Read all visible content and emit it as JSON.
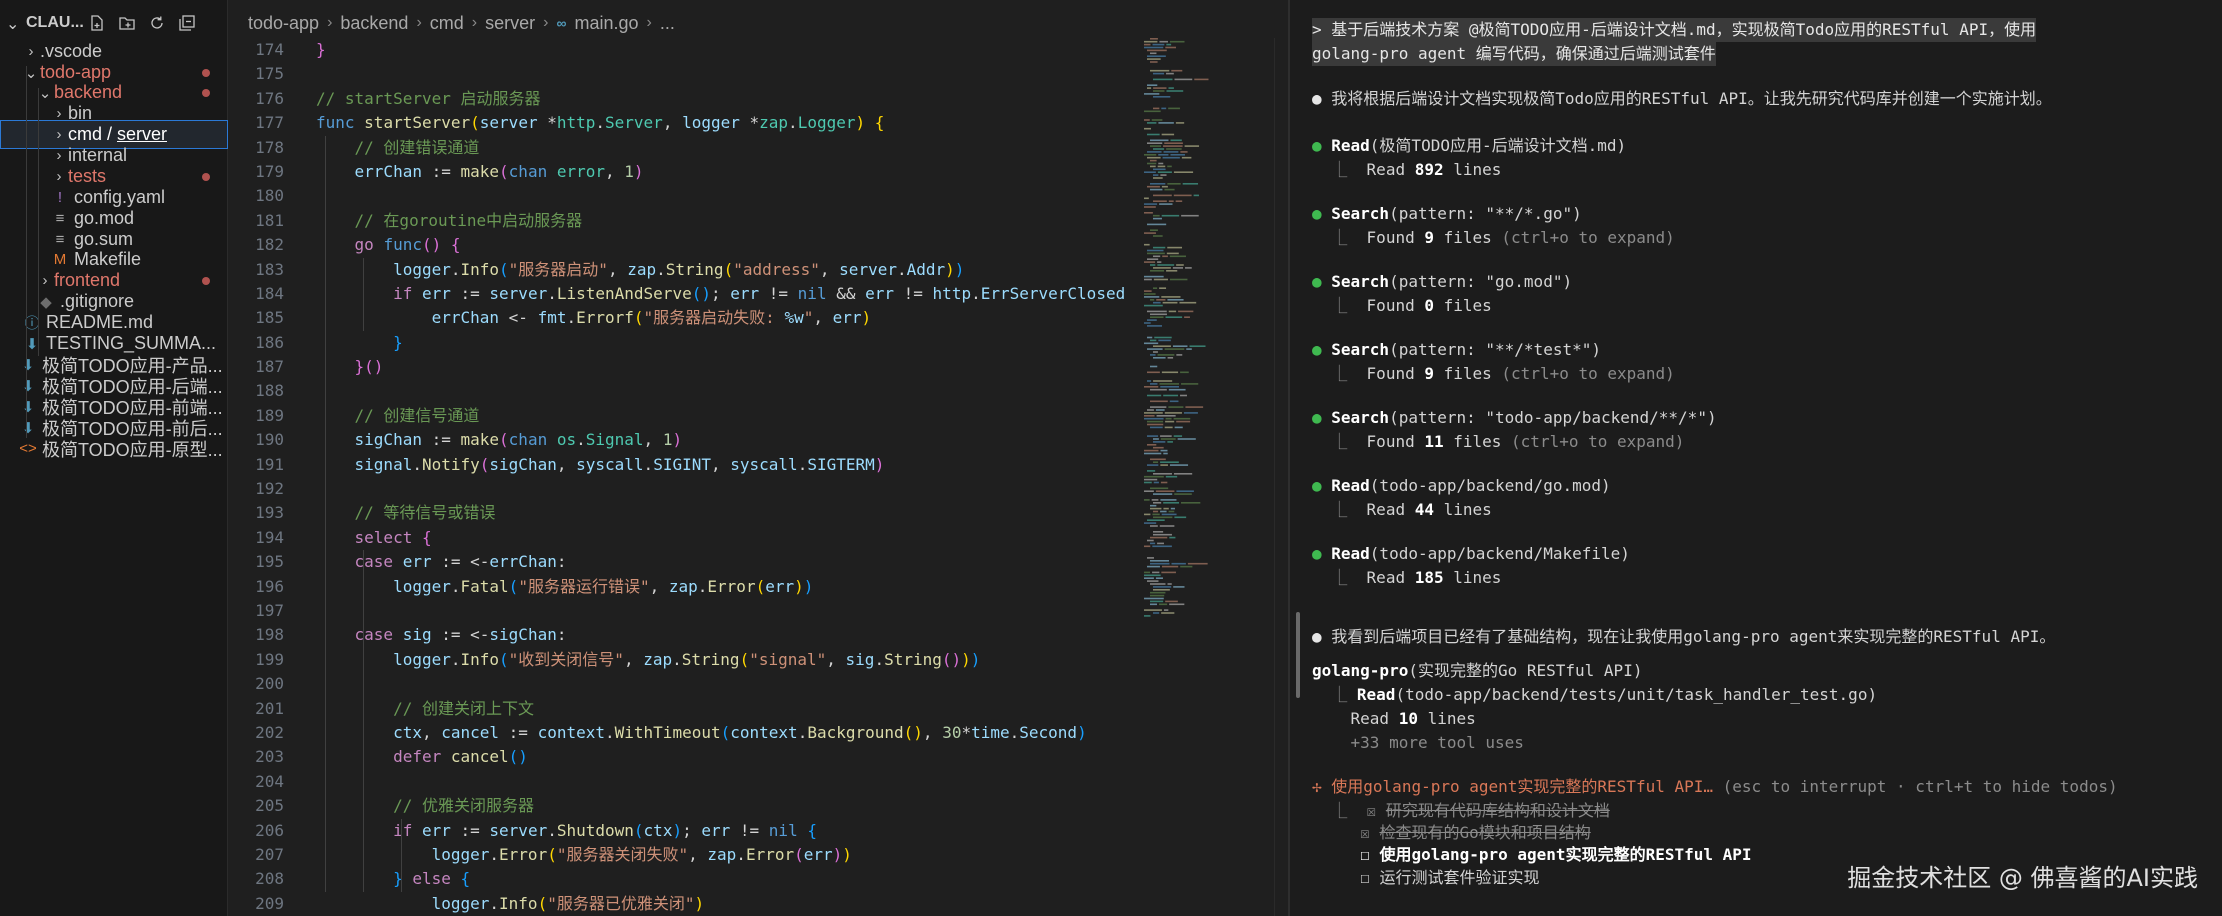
{
  "explorer": {
    "title": "CLAU...",
    "tree": [
      {
        "label": "→"
      },
      {
        "label": ".vscode",
        "indent": 1,
        "twisty": "›",
        "icon": "",
        "color": "#cccccc"
      },
      {
        "label": "todo-app",
        "indent": 1,
        "twisty": "⌄",
        "icon": "",
        "color": "#e0776b",
        "dot": true
      },
      {
        "label": "backend",
        "indent": 2,
        "twisty": "⌄",
        "icon": "",
        "color": "#e0776b",
        "dot": true
      },
      {
        "label": "bin",
        "indent": 3,
        "twisty": "›",
        "icon": "",
        "color": "#cccccc"
      },
      {
        "label": "cmd / server",
        "indent": 3,
        "twisty": "›",
        "icon": "",
        "color": "#ffffff",
        "selected": true
      },
      {
        "label": "internal",
        "indent": 3,
        "twisty": "›",
        "icon": "",
        "color": "#cccccc"
      },
      {
        "label": "tests",
        "indent": 3,
        "twisty": "›",
        "icon": "",
        "color": "#e0776b",
        "dot": true
      },
      {
        "label": "config.yaml",
        "indent": 3,
        "twisty": "",
        "icon": "!",
        "iconColor": "#a074c4",
        "color": "#cccccc"
      },
      {
        "label": "go.mod",
        "indent": 3,
        "twisty": "",
        "icon": "≡",
        "iconColor": "#aaaaaa",
        "color": "#cccccc"
      },
      {
        "label": "go.sum",
        "indent": 3,
        "twisty": "",
        "icon": "≡",
        "iconColor": "#aaaaaa",
        "color": "#cccccc"
      },
      {
        "label": "Makefile",
        "indent": 3,
        "twisty": "",
        "icon": "M",
        "iconColor": "#e37933",
        "color": "#cccccc"
      },
      {
        "label": "frontend",
        "indent": 2,
        "twisty": "›",
        "icon": "",
        "color": "#e0776b",
        "dot": true
      },
      {
        "label": ".gitignore",
        "indent": 2,
        "twisty": "",
        "icon": "◆",
        "iconColor": "#6d6d6d",
        "color": "#cccccc"
      },
      {
        "label": "README.md",
        "indent": 1,
        "twisty": "",
        "icon": "ⓘ",
        "iconColor": "#519aba",
        "color": "#cccccc"
      },
      {
        "label": "TESTING_SUMMA...",
        "indent": 1,
        "twisty": "",
        "icon": "⬇",
        "iconColor": "#519aba",
        "color": "#cccccc"
      },
      {
        "label": "极简TODO应用-产品...",
        "indent": 0,
        "twisty": "",
        "icon": "⬇",
        "iconColor": "#519aba",
        "color": "#cccccc"
      },
      {
        "label": "极简TODO应用-后端...",
        "indent": 0,
        "twisty": "",
        "icon": "⬇",
        "iconColor": "#519aba",
        "color": "#cccccc"
      },
      {
        "label": "极简TODO应用-前端...",
        "indent": 0,
        "twisty": "",
        "icon": "⬇",
        "iconColor": "#519aba",
        "color": "#cccccc"
      },
      {
        "label": "极简TODO应用-前后...",
        "indent": 0,
        "twisty": "",
        "icon": "⬇",
        "iconColor": "#519aba",
        "color": "#cccccc"
      },
      {
        "label": "极简TODO应用-原型...",
        "indent": 0,
        "twisty": "",
        "icon": "<>",
        "iconColor": "#e37933",
        "color": "#cccccc"
      }
    ]
  },
  "breadcrumbs": [
    "todo-app",
    "backend",
    "cmd",
    "server",
    "main.go",
    "..."
  ],
  "editor": {
    "lines": [
      {
        "n": "174",
        "html": "<span class='br2'>}</span>"
      },
      {
        "n": "175",
        "html": ""
      },
      {
        "n": "176",
        "html": "<span class='cm'>// startServer 启动服务器</span>"
      },
      {
        "n": "177",
        "html": "<span class='kw'>func</span> <span class='fn'>startServer</span><span class='br1'>(</span><span class='vr'>server</span> *<span class='ty'>http</span>.<span class='ty'>Server</span>, <span class='vr'>logger</span> *<span class='ty'>zap</span>.<span class='ty'>Logger</span><span class='br1'>)</span> <span class='br1'>{</span>"
      },
      {
        "n": "178",
        "html": "    <span class='cm'>// 创建错误通道</span>"
      },
      {
        "n": "179",
        "html": "    <span class='vr'>errChan</span> := <span class='fn'>make</span><span class='br2'>(</span><span class='kw'>chan</span> <span class='ty'>error</span>, <span class='nm'>1</span><span class='br2'>)</span>"
      },
      {
        "n": "180",
        "html": ""
      },
      {
        "n": "181",
        "html": "    <span class='cm'>// 在goroutine中启动服务器</span>"
      },
      {
        "n": "182",
        "html": "    <span class='ct'>go</span> <span class='kw'>func</span><span class='br2'>()</span> <span class='br2'>{</span>"
      },
      {
        "n": "183",
        "html": "        <span class='vr'>logger</span>.<span class='fn'>Info</span><span class='br3'>(</span><span class='st'>\"服务器启动\"</span>, <span class='vr'>zap</span>.<span class='fn'>String</span><span class='br1'>(</span><span class='st'>\"address\"</span>, <span class='vr'>server</span>.<span class='vr'>Addr</span><span class='br1'>)</span><span class='br3'>)</span>"
      },
      {
        "n": "184",
        "html": "        <span class='ct'>if</span> <span class='vr'>err</span> := <span class='vr'>server</span>.<span class='fn'>ListenAndServe</span><span class='br3'>()</span>; <span class='vr'>err</span> != <span class='kw'>nil</span> &amp;&amp; <span class='vr'>err</span> != <span class='vr'>http</span>.<span class='vr'>ErrServerClosed</span>"
      },
      {
        "n": "185",
        "html": "            <span class='vr'>errChan</span> &lt;- <span class='vr'>fmt</span>.<span class='fn'>Errorf</span><span class='br1'>(</span><span class='st'>\"服务器启动失败: </span><span class='vr'>%w</span><span class='st'>\"</span>, <span class='vr'>err</span><span class='br1'>)</span>"
      },
      {
        "n": "186",
        "html": "        <span class='br3'>}</span>"
      },
      {
        "n": "187",
        "html": "    <span class='br2'>}</span><span class='br2'>()</span>"
      },
      {
        "n": "188",
        "html": ""
      },
      {
        "n": "189",
        "html": "    <span class='cm'>// 创建信号通道</span>"
      },
      {
        "n": "190",
        "html": "    <span class='vr'>sigChan</span> := <span class='fn'>make</span><span class='br2'>(</span><span class='kw'>chan</span> <span class='ty'>os</span>.<span class='ty'>Signal</span>, <span class='nm'>1</span><span class='br2'>)</span>"
      },
      {
        "n": "191",
        "html": "    <span class='vr'>signal</span>.<span class='fn'>Notify</span><span class='br2'>(</span><span class='vr'>sigChan</span>, <span class='vr'>syscall</span>.<span class='vr'>SIGINT</span>, <span class='vr'>syscall</span>.<span class='vr'>SIGTERM</span><span class='br2'>)</span>"
      },
      {
        "n": "192",
        "html": ""
      },
      {
        "n": "193",
        "html": "    <span class='cm'>// 等待信号或错误</span>"
      },
      {
        "n": "194",
        "html": "    <span class='ct'>select</span> <span class='br2'>{</span>"
      },
      {
        "n": "195",
        "html": "    <span class='ct'>case</span> <span class='vr'>err</span> := &lt;-<span class='vr'>errChan</span>:"
      },
      {
        "n": "196",
        "html": "        <span class='vr'>logger</span>.<span class='fn'>Fatal</span><span class='br3'>(</span><span class='st'>\"服务器运行错误\"</span>, <span class='vr'>zap</span>.<span class='fn'>Error</span><span class='br1'>(</span><span class='vr'>err</span><span class='br1'>)</span><span class='br3'>)</span>"
      },
      {
        "n": "197",
        "html": ""
      },
      {
        "n": "198",
        "html": "    <span class='ct'>case</span> <span class='vr'>sig</span> := &lt;-<span class='vr'>sigChan</span>:"
      },
      {
        "n": "199",
        "html": "        <span class='vr'>logger</span>.<span class='fn'>Info</span><span class='br3'>(</span><span class='st'>\"收到关闭信号\"</span>, <span class='vr'>zap</span>.<span class='fn'>String</span><span class='br1'>(</span><span class='st'>\"signal\"</span>, <span class='vr'>sig</span>.<span class='fn'>String</span><span class='br2'>()</span><span class='br1'>)</span><span class='br3'>)</span>"
      },
      {
        "n": "200",
        "html": ""
      },
      {
        "n": "201",
        "html": "        <span class='cm'>// 创建关闭上下文</span>"
      },
      {
        "n": "202",
        "html": "        <span class='vr'>ctx</span>, <span class='vr'>cancel</span> := <span class='vr'>context</span>.<span class='fn'>WithTimeout</span><span class='br3'>(</span><span class='vr'>context</span>.<span class='fn'>Background</span><span class='br1'>()</span>, <span class='nm'>30</span>*<span class='vr'>time</span>.<span class='vr'>Second</span><span class='br3'>)</span>"
      },
      {
        "n": "203",
        "html": "        <span class='ct'>defer</span> <span class='fn'>cancel</span><span class='br3'>()</span>"
      },
      {
        "n": "204",
        "html": ""
      },
      {
        "n": "205",
        "html": "        <span class='cm'>// 优雅关闭服务器</span>"
      },
      {
        "n": "206",
        "html": "        <span class='ct'>if</span> <span class='vr'>err</span> := <span class='vr'>server</span>.<span class='fn'>Shutdown</span><span class='br3'>(</span><span class='vr'>ctx</span><span class='br3'>)</span>; <span class='vr'>err</span> != <span class='kw'>nil</span> <span class='br3'>{</span>"
      },
      {
        "n": "207",
        "html": "            <span class='vr'>logger</span>.<span class='fn'>Error</span><span class='br1'>(</span><span class='st'>\"服务器关闭失败\"</span>, <span class='vr'>zap</span>.<span class='fn'>Error</span><span class='br2'>(</span><span class='vr'>err</span><span class='br2'>)</span><span class='br1'>)</span>"
      },
      {
        "n": "208",
        "html": "        <span class='br3'>}</span> <span class='ct'>else</span> <span class='br3'>{</span>"
      },
      {
        "n": "209",
        "html": "            <span class='vr'>logger</span>.<span class='fn'>Info</span><span class='br1'>(</span><span class='st'>\"服务器已优雅关闭\"</span><span class='br1'>)</span>"
      }
    ]
  },
  "terminal": {
    "prompt_line1": "> 基于后端技术方案 @极简TODO应用-后端设计文档.md，实现极简Todo应用的RESTful API，使用",
    "prompt_line2": "golang-pro agent 编写代码，确保通过后端测试套件",
    "intro": "我将根据后端设计文档实现极简Todo应用的RESTful API。让我先研究代码库并创建一个实施计划。",
    "tool_calls": [
      {
        "tool": "Read",
        "arg": "(极简TODO应用-后端设计文档.md)",
        "res_pre": "Read ",
        "res_num": "892",
        "res_post": " lines",
        "hint": ""
      },
      {
        "tool": "Search",
        "arg": "(pattern: \"**/*.go\")",
        "res_pre": "Found ",
        "res_num": "9",
        "res_post": " files",
        "hint": " (ctrl+o to expand)"
      },
      {
        "tool": "Search",
        "arg": "(pattern: \"go.mod\")",
        "res_pre": "Found ",
        "res_num": "0",
        "res_post": " files",
        "hint": ""
      },
      {
        "tool": "Search",
        "arg": "(pattern: \"**/*test*\")",
        "res_pre": "Found ",
        "res_num": "9",
        "res_post": " files",
        "hint": " (ctrl+o to expand)"
      },
      {
        "tool": "Search",
        "arg": "(pattern: \"todo-app/backend/**/*\")",
        "res_pre": "Found ",
        "res_num": "11",
        "res_post": " files",
        "hint": " (ctrl+o to expand)"
      },
      {
        "tool": "Read",
        "arg": "(todo-app/backend/go.mod)",
        "res_pre": "Read ",
        "res_num": "44",
        "res_post": " lines",
        "hint": ""
      },
      {
        "tool": "Read",
        "arg": "(todo-app/backend/Makefile)",
        "res_pre": "Read ",
        "res_num": "185",
        "res_post": " lines",
        "hint": ""
      }
    ],
    "observation": "我看到后端项目已经有了基础结构，现在让我使用golang-pro agent来实现完整的RESTful API。",
    "agent_name": "golang-pro",
    "agent_desc": "(实现完整的Go RESTful API)",
    "agent_tool": "Read",
    "agent_tool_arg": "(todo-app/backend/tests/unit/task_handler_test.go)",
    "agent_res_pre": "Read ",
    "agent_res_num": "10",
    "agent_res_post": " lines",
    "agent_more": "+33 more tool uses",
    "status_spinner": "✢",
    "status_text": "使用golang-pro agent实现完整的RESTful API…",
    "status_hint": " (esc to interrupt · ctrl+t to hide todos)",
    "todos": [
      {
        "box": "☒",
        "text": "研究现有代码库结构和设计文档",
        "state": "done"
      },
      {
        "box": "☒",
        "text": "检查现有的Go模块和项目结构",
        "state": "done"
      },
      {
        "box": "☐",
        "text": "使用golang-pro agent实现完整的RESTful API",
        "state": "active"
      },
      {
        "box": "☐",
        "text": "运行测试套件验证实现",
        "state": "pending"
      }
    ],
    "watermark": "掘金技术社区 @ 佛喜酱的AI实践"
  }
}
